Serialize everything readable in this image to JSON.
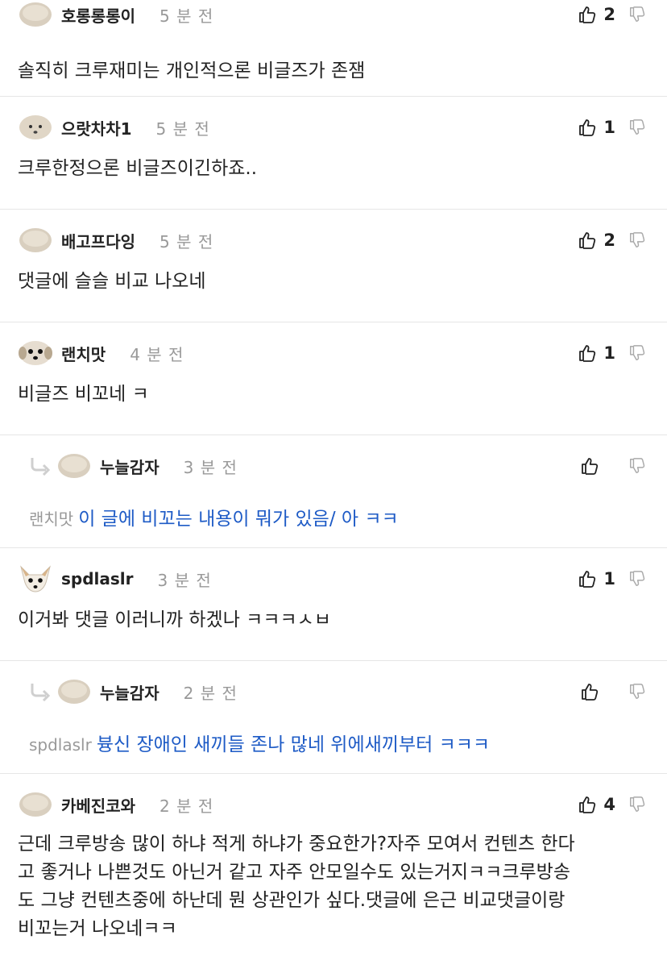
{
  "comments": [
    {
      "nick": "호롱롱롱이",
      "time": "5 분 전",
      "likes": "2",
      "avatar": "puppy-round-avatar",
      "text": "솔직히 크루재미는 개인적으론 비글즈가 존잼",
      "is_reply": false
    },
    {
      "nick": "으랏차차1",
      "time": "5 분 전",
      "likes": "1",
      "avatar": "puppy-face-avatar",
      "text": "크루한정으론 비글즈이긴하죠..",
      "is_reply": false
    },
    {
      "nick": "배고프다잉",
      "time": "5 분 전",
      "likes": "2",
      "avatar": "puppy-round-avatar",
      "text": "댓글에 슬슬 비교 나오네",
      "is_reply": false
    },
    {
      "nick": "랜치맛",
      "time": "4 분 전",
      "likes": "1",
      "avatar": "puppy-dark-eyes-avatar",
      "text": "비글즈 비꼬네 ㅋ",
      "is_reply": false
    },
    {
      "nick": "누늘감자",
      "time": "3 분 전",
      "likes": "",
      "avatar": "puppy-round-avatar",
      "mention": "랜치맛",
      "text": "이 글에 비꼬는 내용이 뭐가 있음/ 아 ㅋㅋ",
      "is_reply": true
    },
    {
      "nick": "spdlaslr",
      "time": "3 분 전",
      "likes": "1",
      "avatar": "chihuahua-avatar",
      "text": "이거봐 댓글 이러니까 하겠나 ㅋㅋㅋㅅㅂ",
      "is_reply": false
    },
    {
      "nick": "누늘감자",
      "time": "2 분 전",
      "likes": "",
      "avatar": "puppy-round-avatar",
      "mention": "spdlaslr",
      "text": "븅신 장애인 새끼들 존나 많네 위에새끼부터 ㅋㅋㅋ",
      "is_reply": true
    },
    {
      "nick": "카베진코와",
      "time": "2 분 전",
      "likes": "4",
      "avatar": "puppy-round-avatar",
      "text_lines": [
        "근데 크루방송 많이 하냐 적게 하냐가 중요한가?자주 모여서 컨텐츠 한다",
        "고 좋거나 나쁜것도 아닌거 같고 자주 안모일수도 있는거지ㅋㅋ크루방송",
        "도 그냥 컨텐츠중에 하난데 뭔 상관인가 싶다.댓글에 은근 비교댓글이랑",
        "비꼬는거 나오네ㅋㅋ"
      ],
      "is_reply": false
    }
  ],
  "colors": {
    "reply_text": "#1e5bc6",
    "muted": "#999999",
    "divider": "#e6e6e6"
  }
}
